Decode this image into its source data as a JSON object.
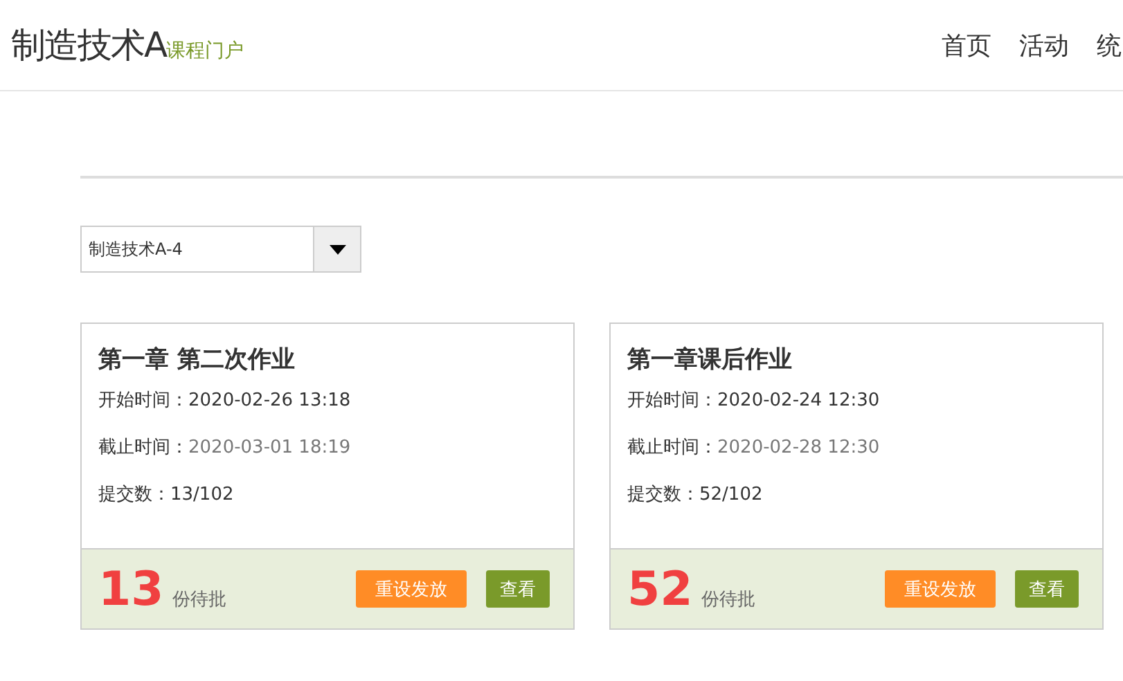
{
  "header": {
    "title": "制造技术A",
    "subtitle": "课程门户",
    "nav": [
      "首页",
      "活动",
      "统"
    ]
  },
  "class_select": {
    "value": "制造技术A-4"
  },
  "assignments": [
    {
      "title": "第一章 第二次作业",
      "start_label": "开始时间：",
      "start": "2020-02-26 13:18",
      "end_label": "截止时间：",
      "end": "2020-03-01 18:19",
      "submit_label": "提交数：",
      "submitted": "13/102",
      "pending": "13",
      "pending_label": "份待批",
      "buttons": [
        "重设发放",
        "查看"
      ]
    },
    {
      "title": "第一章课后作业",
      "start_label": "开始时间：",
      "start": "2020-02-24 12:30",
      "end_label": "截止时间：",
      "end": "2020-02-28 12:30",
      "submit_label": "提交数：",
      "submitted": "52/102",
      "pending": "52",
      "pending_label": "份待批",
      "buttons": [
        "重设发放",
        "查看"
      ]
    }
  ]
}
